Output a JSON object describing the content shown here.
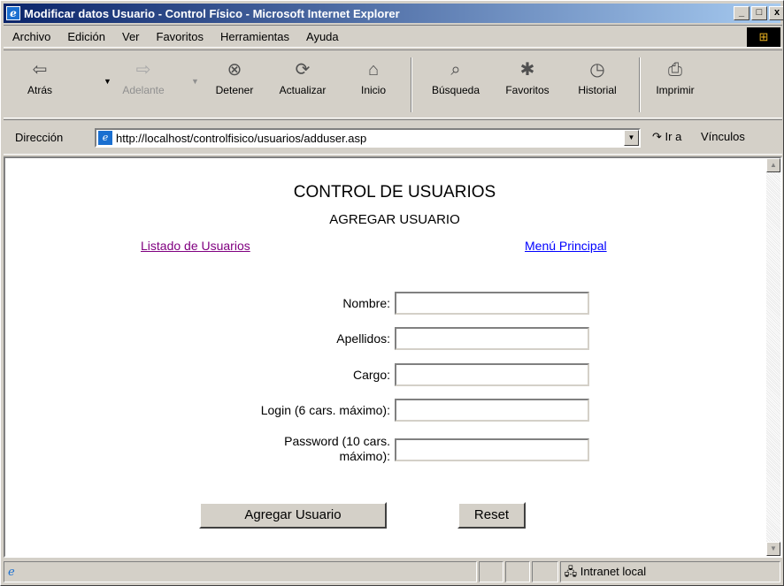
{
  "window": {
    "title": "Modificar datos Usuario - Control Físico - Microsoft Internet Explorer",
    "min": "_",
    "max": "□",
    "close": "x"
  },
  "menu": [
    "Archivo",
    "Edición",
    "Ver",
    "Favoritos",
    "Herramientas",
    "Ayuda"
  ],
  "toolbar": {
    "back": "Atrás",
    "forward": "Adelante",
    "stop": "Detener",
    "refresh": "Actualizar",
    "home": "Inicio",
    "search": "Búsqueda",
    "favorites": "Favoritos",
    "history": "Historial",
    "print": "Imprimir"
  },
  "address": {
    "label": "Dirección",
    "url": "http://localhost/controlfisico/usuarios/adduser.asp",
    "go": "Ir a",
    "links": "Vínculos"
  },
  "page": {
    "title": "CONTROL DE USUARIOS",
    "subtitle": "AGREGAR USUARIO",
    "link_list": "Listado de Usuarios",
    "link_menu": "Menú Principal",
    "fields": {
      "nombre": "Nombre:",
      "apellidos": "Apellidos:",
      "cargo": "Cargo:",
      "login": "Login (6 cars. máximo):",
      "password": "Password (10 cars. máximo):"
    },
    "submit": "Agregar Usuario",
    "reset": "Reset"
  },
  "status": {
    "zone": "Intranet local"
  }
}
